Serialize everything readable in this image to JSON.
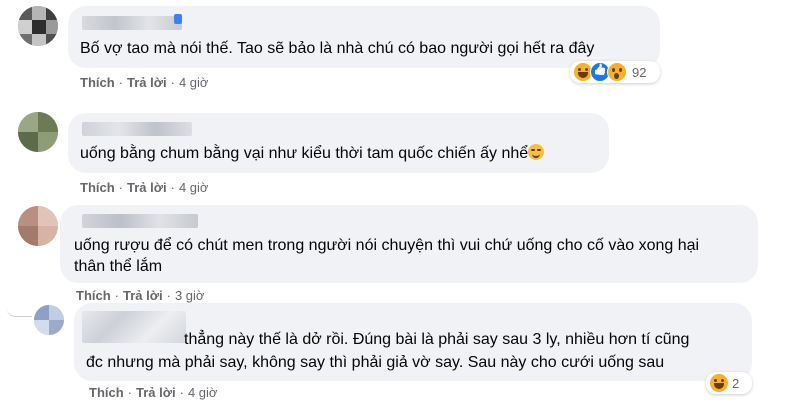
{
  "comments": [
    {
      "text_lines": [
        "Bố vợ tao mà nói thế. Tao sẽ bảo là nhà chú có bao người gọi hết ra đây"
      ],
      "actions": {
        "like": "Thích",
        "reply": "Trả lời",
        "time": "4 giờ"
      },
      "reactions": {
        "icons": [
          "haha-icon",
          "like-icon",
          "wow-icon"
        ],
        "count": "92"
      }
    },
    {
      "text_lines": [
        "uống bằng chum bằng vại như kiểu thời tam quốc chiến ấy nhể"
      ],
      "trailing_emoji": "grin-emoji",
      "actions": {
        "like": "Thích",
        "reply": "Trả lời",
        "time": "4 giờ"
      }
    },
    {
      "text_lines": [
        "uống rượu để có chút men trong người nói chuyện thì vui chứ uống cho cố vào xong hại",
        "thân thể lắm"
      ],
      "actions": {
        "like": "Thích",
        "reply": "Trả lời",
        "time": "3 giờ"
      }
    },
    {
      "text_lines": [
        "thẳng này thế là dở rồi. Đúng bài là phải say sau 3 ly, nhiều hơn tí cũng",
        "đc nhưng mà phải say, không say thì phải giả vờ say. Sau này cho cưới uống sau"
      ],
      "actions": {
        "like": "Thích",
        "reply": "Trả lời",
        "time": "4 giờ"
      },
      "reactions": {
        "icons": [
          "haha-icon"
        ],
        "count": "2"
      }
    }
  ],
  "colors": {
    "bubble": "#f0f2f5",
    "action_text": "#65676b",
    "like_blue": "#1877f2",
    "emoji_yellow": "#f7b125"
  }
}
